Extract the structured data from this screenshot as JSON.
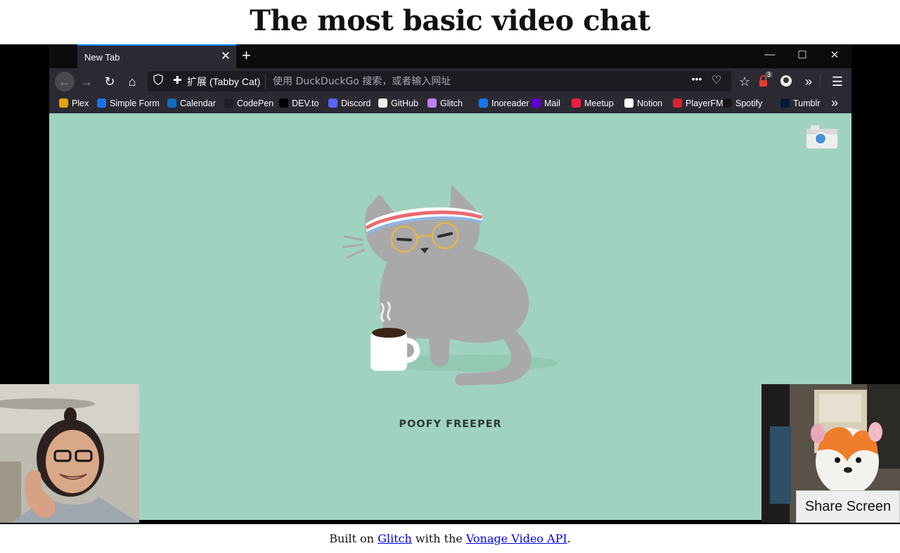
{
  "page": {
    "title": "The most basic video chat"
  },
  "browser": {
    "tab_title": "New Tab",
    "tab_close_glyph": "✕",
    "new_tab_glyph": "+",
    "window_controls": {
      "minimize": "—",
      "maximize": "☐",
      "close": "✕"
    },
    "nav": {
      "back": "←",
      "forward": "→",
      "reload": "↻",
      "home": "⌂",
      "more": "•••",
      "extensions_count": "3",
      "overflow": "»",
      "menu": "☰"
    },
    "extension_label": "扩展 (Tabby Cat)",
    "url_placeholder": "使用 DuckDuckGo 搜索，或者输入网址",
    "bookmarks": [
      {
        "label": "Plex",
        "icon": "plex-icon",
        "color": "#e5a00d"
      },
      {
        "label": "Simple Form",
        "icon": "simple-form-icon",
        "color": "#1a73e8"
      },
      {
        "label": "Calendar",
        "icon": "calendar-icon",
        "color": "#0f6cbd"
      },
      {
        "label": "CodePen",
        "icon": "codepen-icon",
        "color": "#1e1f26"
      },
      {
        "label": "DEV.to",
        "icon": "dev-icon",
        "color": "#000000"
      },
      {
        "label": "Discord",
        "icon": "discord-icon",
        "color": "#5865f2"
      },
      {
        "label": "GitHub",
        "icon": "github-icon",
        "color": "#eeeeee"
      },
      {
        "label": "Glitch",
        "icon": "glitch-icon",
        "color": "#c07ff5"
      },
      {
        "label": "Inoreader",
        "icon": "inoreader-icon",
        "color": "#1875f0"
      },
      {
        "label": "Mail",
        "icon": "mail-icon",
        "color": "#6001d2"
      },
      {
        "label": "Meetup",
        "icon": "meetup-icon",
        "color": "#ed1c40"
      },
      {
        "label": "Notion",
        "icon": "notion-icon",
        "color": "#ffffff"
      },
      {
        "label": "PlayerFM",
        "icon": "playerfm-icon",
        "color": "#d9232e"
      },
      {
        "label": "Spotify",
        "icon": "spotify-icon",
        "color": "#191414"
      },
      {
        "label": "Tumblr",
        "icon": "tumblr-icon",
        "color": "#001935"
      }
    ],
    "bookmarks_overflow": "»",
    "cat_name": "POOFY FREEPER"
  },
  "share_button": {
    "label": "Share Screen"
  },
  "footer": {
    "prefix": "Built on",
    "glitch_link": "Glitch",
    "middle": "with the",
    "vonage_link": "Vonage Video API",
    "suffix": "."
  },
  "colors": {
    "page_bg": "#ffffff",
    "stage_bg": "#000000",
    "newtab_bg": "#a0d3bf",
    "link": "#0000ee"
  }
}
